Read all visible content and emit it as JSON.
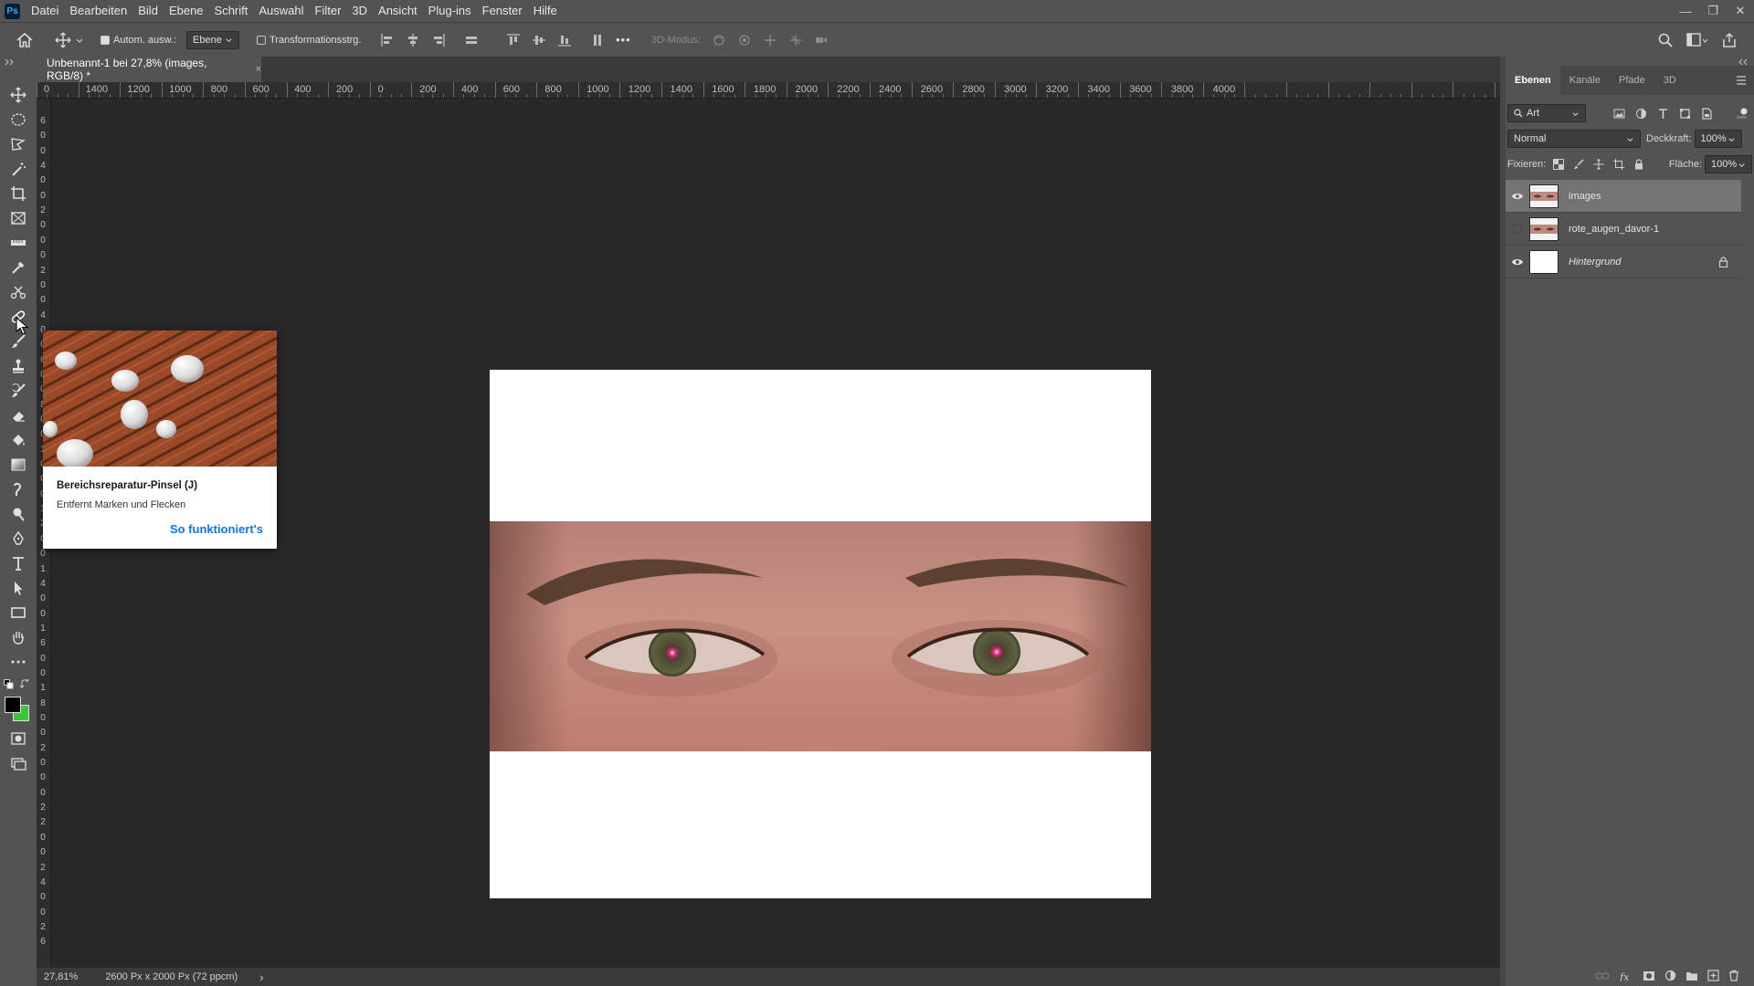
{
  "app": {
    "logo_text": "Ps"
  },
  "menu": [
    "Datei",
    "Bearbeiten",
    "Bild",
    "Ebene",
    "Schrift",
    "Auswahl",
    "Filter",
    "3D",
    "Ansicht",
    "Plug-ins",
    "Fenster",
    "Hilfe"
  ],
  "window_controls": {
    "minimize": "—",
    "restore": "❐",
    "close": "✕"
  },
  "options_bar": {
    "auto_select_label": "Autom. ausw.:",
    "auto_select_checked": true,
    "auto_select_target": "Ebene",
    "transform_controls_label": "Transformationsstrg.",
    "transform_controls_checked": false,
    "more_label": "•••",
    "mode_3d_label": "3D-Modus:"
  },
  "document": {
    "tab_title": "Unbenannt-1 bei 27,8% (images, RGB/8) *",
    "close_glyph": "×"
  },
  "ruler": {
    "horizontal": [
      "0",
      "1400",
      "1200",
      "1000",
      "800",
      "600",
      "400",
      "200",
      "0",
      "200",
      "400",
      "600",
      "800",
      "1000",
      "1200",
      "1400",
      "1600",
      "1800",
      "2000",
      "2200",
      "2400",
      "2600",
      "2800",
      "3000",
      "3200",
      "3400",
      "3600",
      "3800",
      "4000"
    ],
    "vertical": [
      "6",
      "0",
      "0",
      "4",
      "0",
      "0",
      "2",
      "0",
      "0",
      "0",
      "2",
      "0",
      "0",
      "4",
      "0",
      "0",
      "6",
      "0",
      "0",
      "8",
      "0",
      "0",
      "1",
      "0",
      "0",
      "0",
      "1",
      "2",
      "0",
      "0",
      "1",
      "4",
      "0",
      "0",
      "1",
      "6",
      "0",
      "0",
      "1",
      "8",
      "0",
      "0",
      "2",
      "0",
      "0",
      "0",
      "2",
      "2",
      "0",
      "0",
      "2",
      "4",
      "0",
      "0",
      "2",
      "6"
    ]
  },
  "tooltip": {
    "title": "Bereichsreparatur-Pinsel (J)",
    "description": "Entfernt Marken und Flecken",
    "link": "So funktioniert's"
  },
  "status": {
    "zoom": "27,81%",
    "doc_info": "2600 Px x 2000 Px (72 ppcm)",
    "arrow": "›"
  },
  "colors": {
    "foreground": "#000000",
    "background": "#3ec33e",
    "accent_link": "#1473e6"
  },
  "layers_panel": {
    "tabs": [
      "Ebenen",
      "Kanäle",
      "Pfade",
      "3D"
    ],
    "active_tab": "Ebenen",
    "filter_kind": "Art",
    "blend_mode": "Normal",
    "opacity_label": "Deckkraft:",
    "opacity_value": "100%",
    "lock_label": "Fixieren:",
    "fill_label": "Fläche:",
    "fill_value": "100%",
    "layers": [
      {
        "name": "images",
        "visible": true,
        "selected": true,
        "locked": false,
        "thumb": "eyes"
      },
      {
        "name": "rote_augen_davor-1",
        "visible": false,
        "selected": false,
        "locked": false,
        "thumb": "eyes"
      },
      {
        "name": "Hintergrund",
        "visible": true,
        "selected": false,
        "locked": true,
        "thumb": "white"
      }
    ]
  }
}
